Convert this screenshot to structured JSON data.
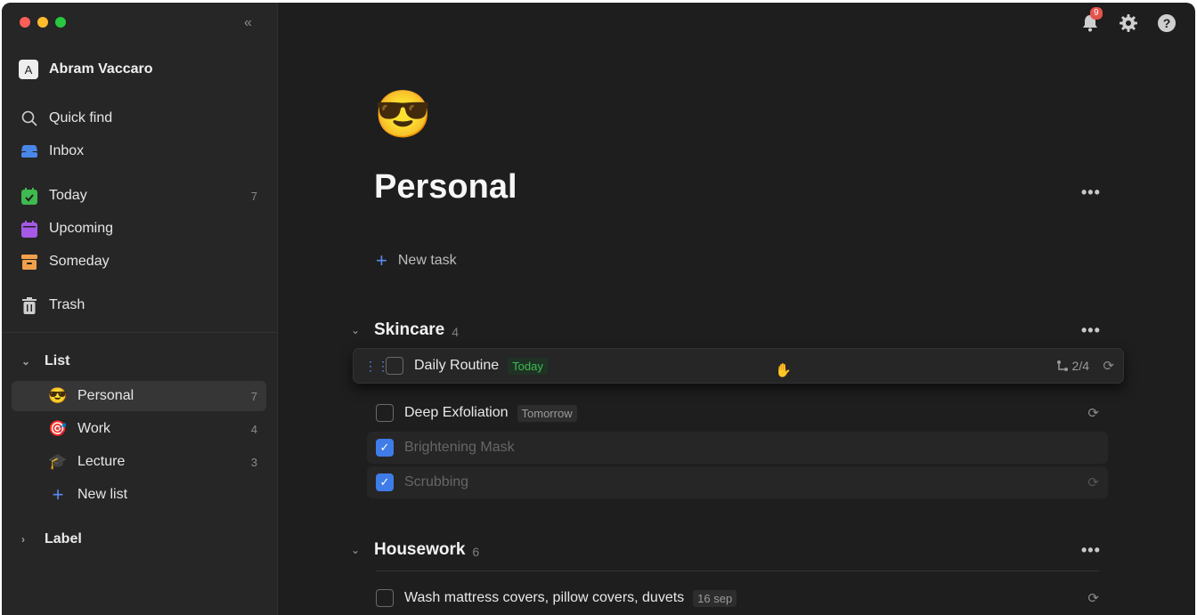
{
  "sidebar": {
    "user": {
      "initial": "A",
      "name": "Abram Vaccaro"
    },
    "nav": [
      {
        "label": "Quick find",
        "icon": "search-icon"
      },
      {
        "label": "Inbox",
        "icon": "inbox-icon"
      },
      {
        "label": "Today",
        "icon": "calendar-check-icon",
        "count": "7"
      },
      {
        "label": "Upcoming",
        "icon": "calendar-icon"
      },
      {
        "label": "Someday",
        "icon": "archive-box-icon"
      },
      {
        "label": "Trash",
        "icon": "trash-icon"
      }
    ],
    "list_section": {
      "label": "List"
    },
    "lists": [
      {
        "label": "Personal",
        "emoji": "😎",
        "count": "7"
      },
      {
        "label": "Work",
        "emoji": "🎯",
        "count": "4"
      },
      {
        "label": "Lecture",
        "emoji": "🎓",
        "count": "3"
      }
    ],
    "new_list": "New list",
    "label_section": {
      "label": "Label"
    }
  },
  "topbar": {
    "notification_count": "9"
  },
  "page": {
    "emoji": "😎",
    "title": "Personal",
    "new_task": "New task"
  },
  "groups": [
    {
      "title": "Skincare",
      "count": "4",
      "tasks": [
        {
          "title": "Daily Routine",
          "tag": "Today",
          "subtasks": "2/4",
          "checked": false
        },
        {
          "title": "Deep Exfoliation",
          "tag": "Tomorrow",
          "checked": false
        },
        {
          "title": "Brightening Mask",
          "checked": true
        },
        {
          "title": "Scrubbing",
          "checked": true
        }
      ]
    },
    {
      "title": "Housework",
      "count": "6",
      "tasks": [
        {
          "title": "Wash mattress covers, pillow covers, duvets",
          "tag": "16 sep",
          "checked": false
        }
      ]
    }
  ],
  "colors": {
    "accent": "#3f7ce8",
    "today_tag": "#3fb950",
    "badge": "#e5534b"
  }
}
